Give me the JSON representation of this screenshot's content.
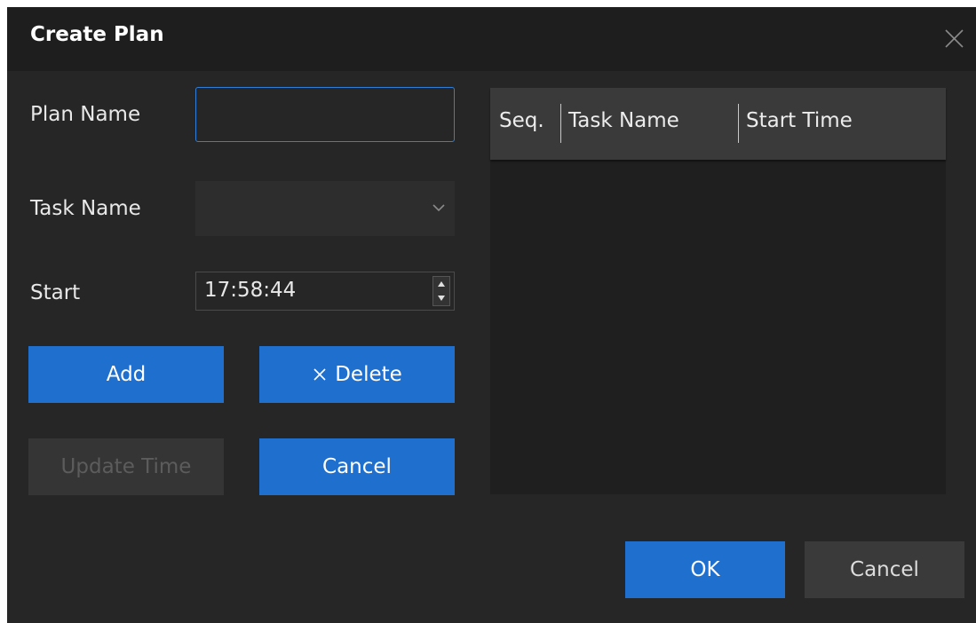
{
  "dialog": {
    "title": "Create Plan",
    "close_icon": "close-icon"
  },
  "form": {
    "plan_name_label": "Plan Name",
    "plan_name_value": "",
    "task_name_label": "Task Name",
    "task_name_selected": "",
    "start_label": "Start",
    "start_value": "17:58:44"
  },
  "buttons": {
    "add": "Add",
    "delete": "Delete",
    "delete_icon": "close-icon",
    "update_time": "Update Time",
    "cancel_inner": "Cancel",
    "ok": "OK",
    "cancel": "Cancel"
  },
  "table": {
    "columns": [
      "Seq.",
      "Task Name",
      "Start Time"
    ],
    "rows": []
  },
  "colors": {
    "accent": "#1f6fce",
    "background": "#262626",
    "titlebar": "#1e1e1e"
  }
}
